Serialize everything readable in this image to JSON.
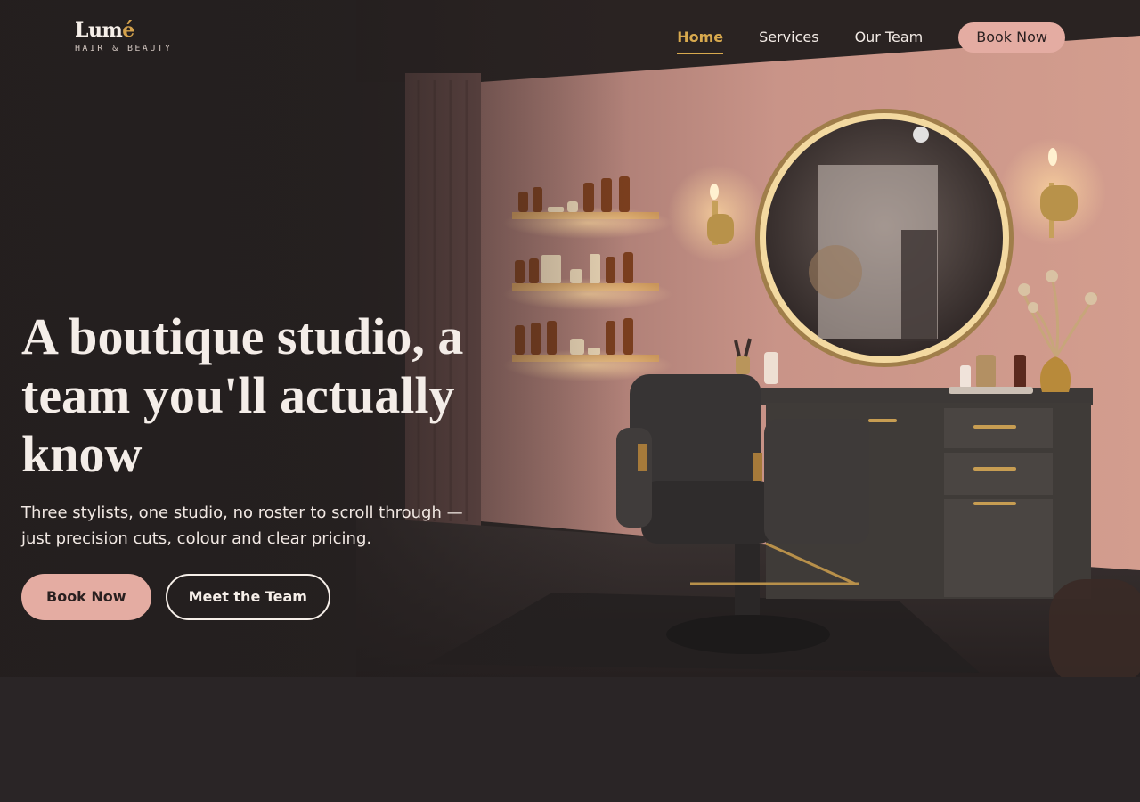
{
  "brand": {
    "name_main": "Lum",
    "name_accent": "é",
    "tagline": "HAIR & BEAUTY"
  },
  "nav": {
    "items": [
      {
        "label": "Home",
        "active": true
      },
      {
        "label": "Services",
        "active": false
      },
      {
        "label": "Our Team",
        "active": false
      }
    ],
    "cta_label": "Book Now"
  },
  "hero": {
    "headline": "A boutique studio, a team you'll actually know",
    "subtext": "Three stylists, one studio, no roster to scroll through — just precision cuts, colour and clear pricing.",
    "primary_button": "Book Now",
    "secondary_button": "Meet the Team",
    "image_subject": "salon-interior-photo"
  },
  "colors": {
    "accent_gold": "#d8a94e",
    "button_pink": "#e4aca2",
    "background_dark": "#2a2526",
    "text_light": "#f4ede8"
  }
}
